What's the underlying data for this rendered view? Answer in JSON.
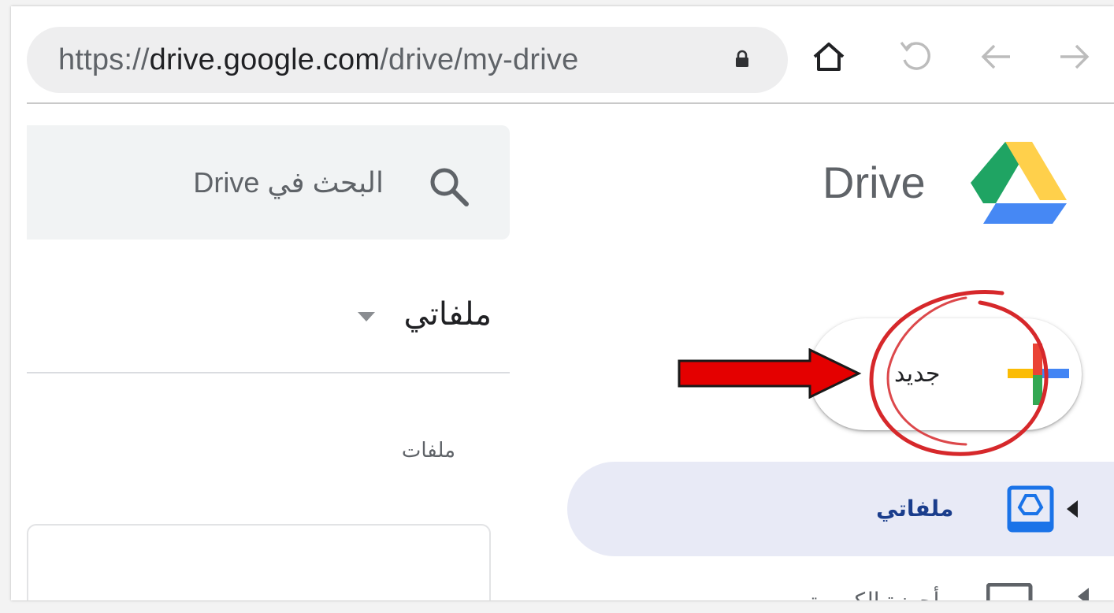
{
  "browser": {
    "url_scheme": "https://",
    "url_host": "drive.google.com",
    "url_path": "/drive/my-drive",
    "icons": [
      "lock-icon",
      "home-icon",
      "reload-icon",
      "back-icon",
      "forward-icon"
    ]
  },
  "app": {
    "title": "Drive",
    "logo_colors": [
      "#1fa463",
      "#ffd04b",
      "#4688f4"
    ]
  },
  "search": {
    "placeholder": "البحث في Drive"
  },
  "header": {
    "title": "ملفاتي"
  },
  "content": {
    "section_label": "ملفات"
  },
  "new_button": {
    "label": "جديد"
  },
  "sidebar": {
    "items": [
      {
        "label": "ملفاتي",
        "icon": "drive-box-icon",
        "active": true
      },
      {
        "label": "أجهزة الكمبيوتر",
        "icon": "computers-icon",
        "active": false
      }
    ]
  },
  "annotations": {
    "arrow_color": "#e40000",
    "circle_color": "#d6282b"
  }
}
